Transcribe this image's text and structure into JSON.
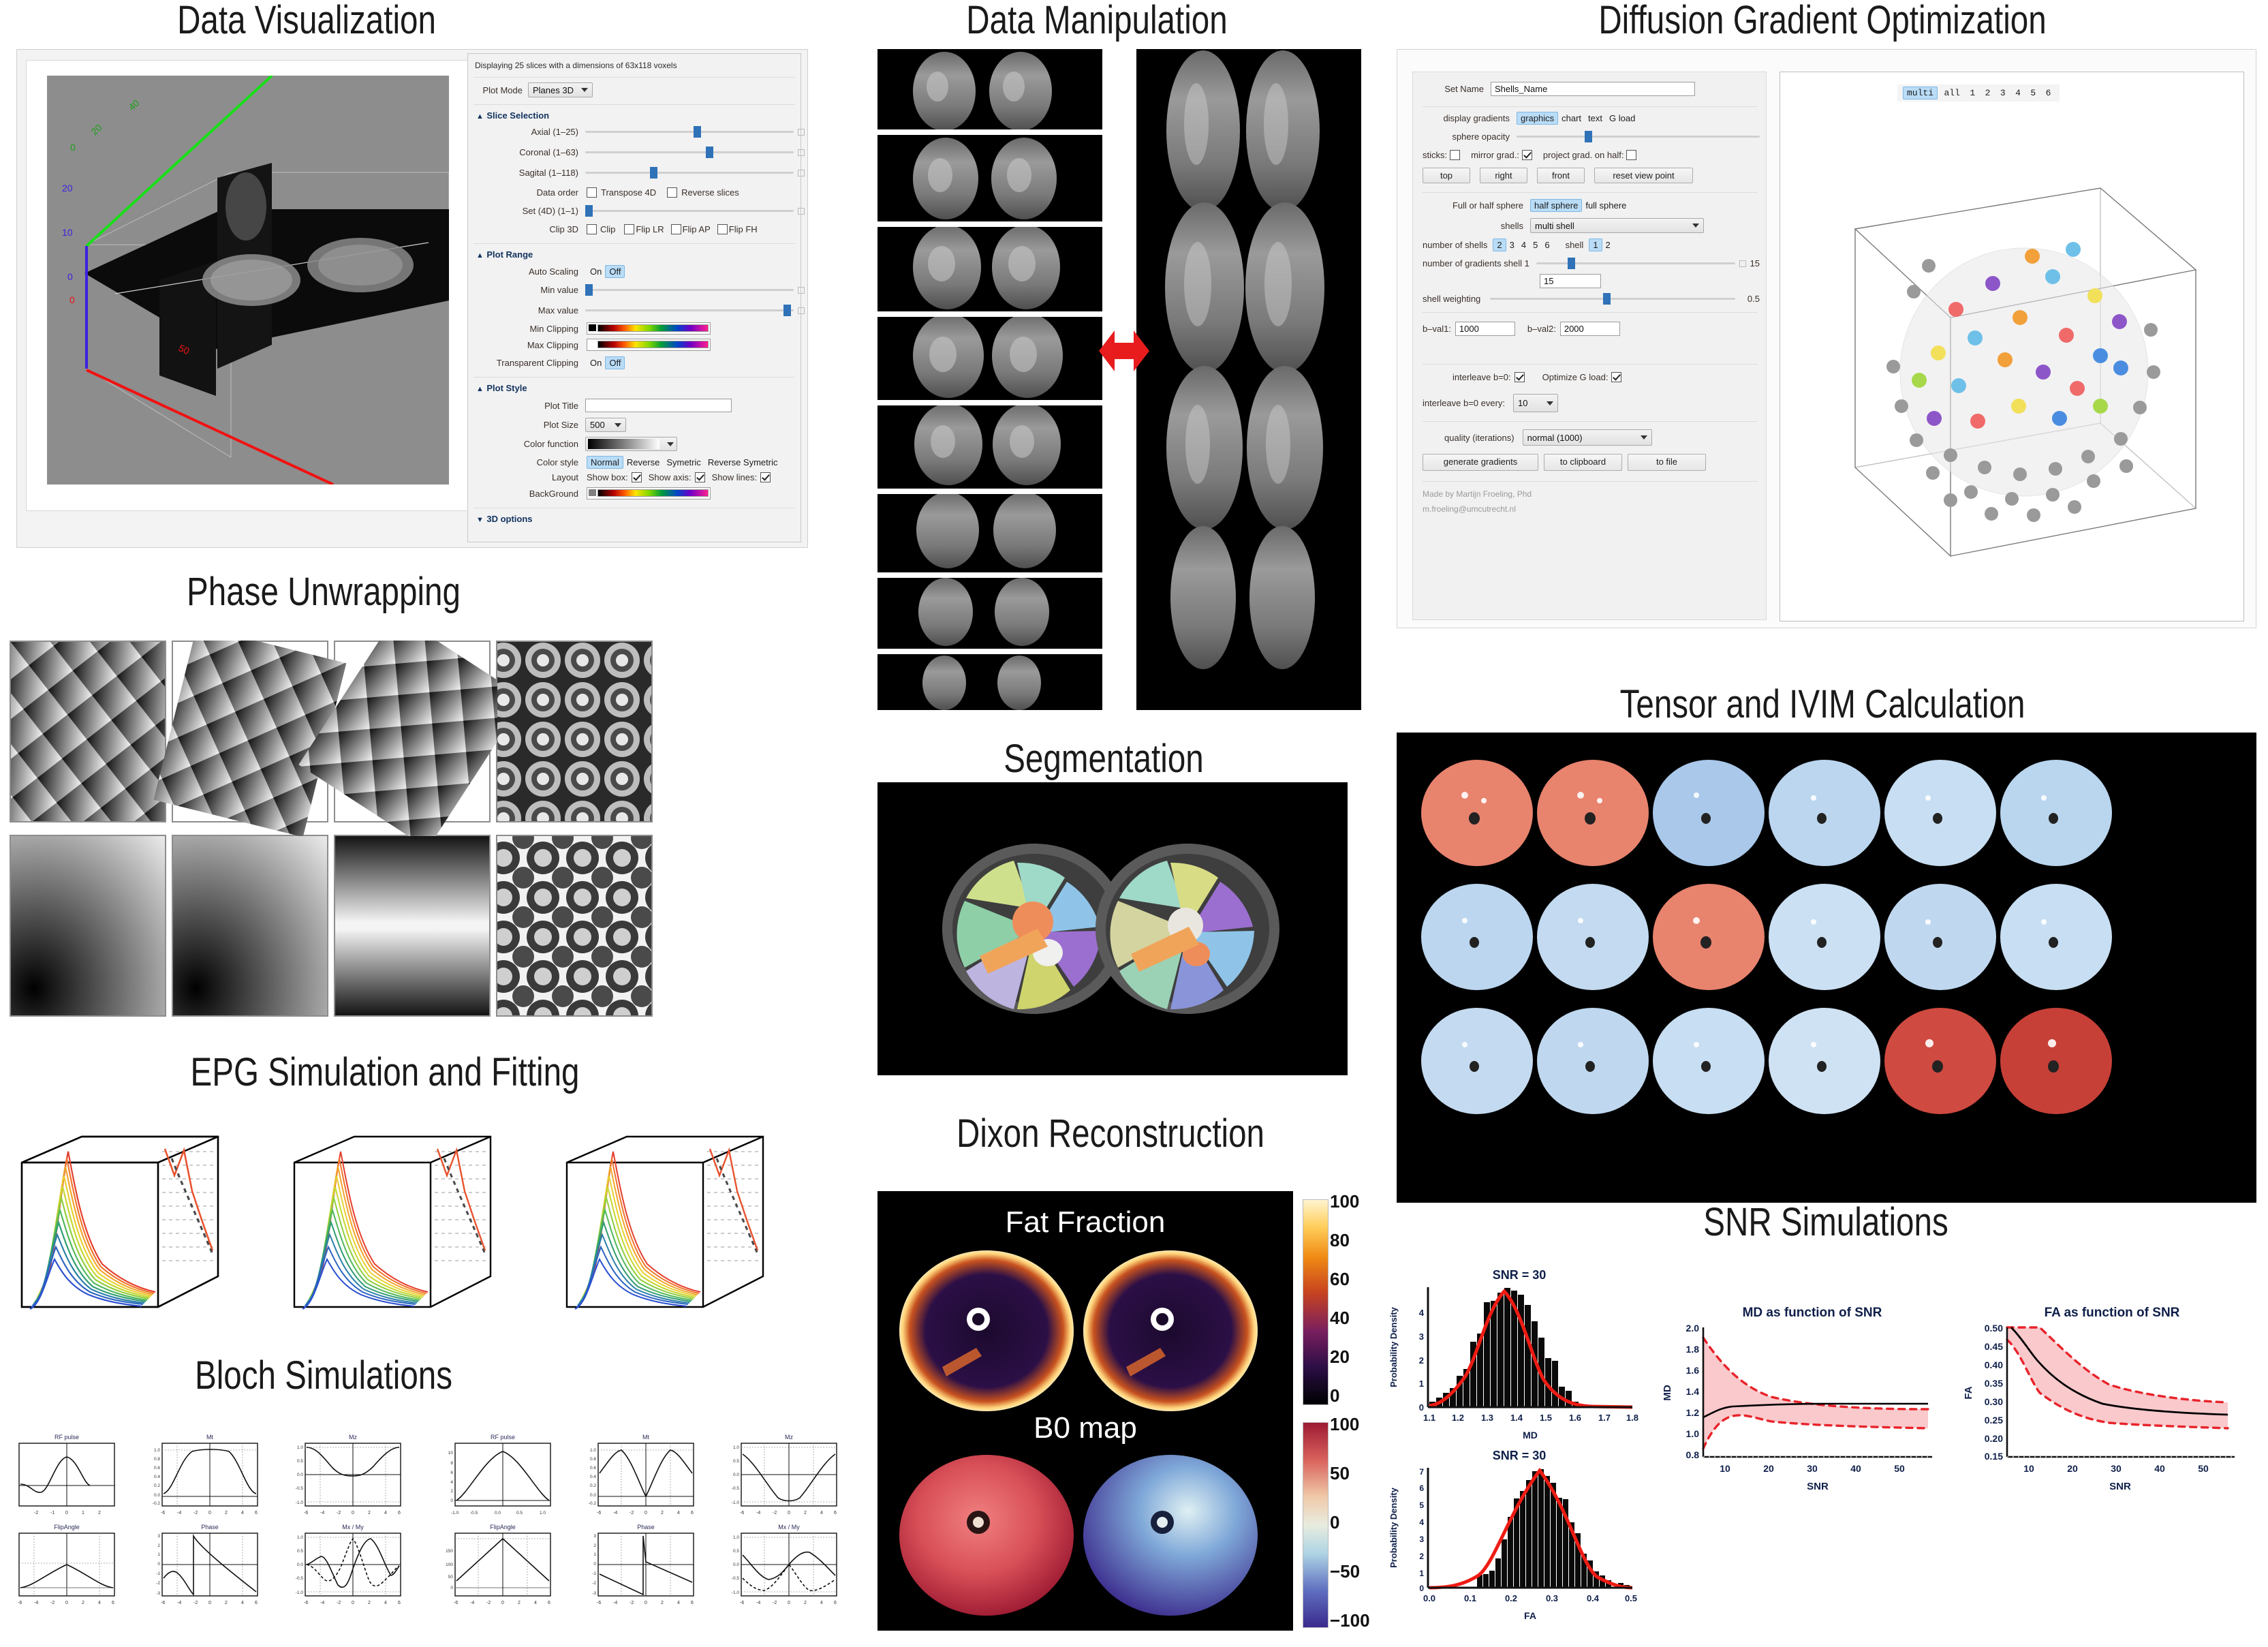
{
  "sections": {
    "data_visualization": "Data Visualization",
    "phase_unwrapping": "Phase Unwrapping",
    "epg": "EPG Simulation and Fitting",
    "bloch": "Bloch Simulations",
    "data_manipulation": "Data Manipulation",
    "segmentation": "Segmentation",
    "dixon": "Dixon Reconstruction",
    "dgo": "Diffusion Gradient Optimization",
    "tensor_ivim": "Tensor and IVIM Calculation",
    "snr": "SNR Simulations"
  },
  "viewer": {
    "status": "Displaying 25 slices with a dimensions of 63x118 voxels",
    "plot_mode_label": "Plot Mode",
    "plot_mode_value": "Planes 3D",
    "slice_selection": {
      "title": "Slice Selection",
      "rows": [
        {
          "label": "Axial (1–25)",
          "pos": 52
        },
        {
          "label": "Coronal (1–63)",
          "pos": 58
        },
        {
          "label": "Sagital (1–118)",
          "pos": 31
        }
      ],
      "data_order_label": "Data order",
      "transpose_label": "Transpose 4D",
      "transpose_checked": false,
      "reverse_label": "Reverse slices",
      "reverse_checked": false,
      "set4d_label": "Set (4D)  (1–1)",
      "set4d_pos": 1,
      "clip3d_label": "Clip 3D",
      "clip_options": [
        {
          "label": "Clip",
          "checked": false
        },
        {
          "label": "Flip LR",
          "checked": false
        },
        {
          "label": "Flip AP",
          "checked": false
        },
        {
          "label": "Flip FH",
          "checked": false
        }
      ]
    },
    "plot_range": {
      "title": "Plot Range",
      "auto_scaling_label": "Auto Scaling",
      "auto_on": "On",
      "auto_off": "Off",
      "auto_selected": "Off",
      "min_value_label": "Min value",
      "min_value_pos": 1,
      "max_value_label": "Max value",
      "max_value_pos": 95,
      "min_clipping_label": "Min Clipping",
      "max_clipping_label": "Max Clipping",
      "transparent_clipping_label": "Transparent Clipping",
      "transparent_on": "On",
      "transparent_off": "Off",
      "transparent_selected": "Off"
    },
    "plot_style": {
      "title": "Plot Style",
      "plot_title_label": "Plot Title",
      "plot_title_value": "",
      "plot_size_label": "Plot Size",
      "plot_size_value": "500",
      "color_function_label": "Color function",
      "color_style_label": "Color style",
      "color_styles": [
        "Normal",
        "Reverse",
        "Symetric",
        "Reverse Symetric"
      ],
      "color_style_selected": "Normal",
      "layout_label": "Layout",
      "layout_options": [
        {
          "label": "Show box:",
          "checked": true
        },
        {
          "label": "Show axis:",
          "checked": true
        },
        {
          "label": "Show lines:",
          "checked": true
        }
      ],
      "background_label": "BackGround"
    },
    "options3d_title": "3D options",
    "axes": {
      "x_ticks": [
        "0",
        "50"
      ],
      "y_ticks": [
        "0",
        "20",
        "40"
      ],
      "z_ticks": [
        "0",
        "10",
        "20"
      ]
    }
  },
  "gradient_tool": {
    "set_name_label": "Set Name",
    "set_name_value": "Shells_Name",
    "display_gradients_label": "display gradients",
    "display_modes": [
      "graphics",
      "chart",
      "text",
      "G load"
    ],
    "display_mode_selected": "graphics",
    "sphere_opacity_label": "sphere opacity",
    "sphere_opacity_pos": 28,
    "sticks_label": "sticks:",
    "sticks_checked": false,
    "mirror_label": "mirror grad.:",
    "mirror_checked": true,
    "project_label": "project grad. on half:",
    "project_checked": false,
    "view_buttons": [
      "top",
      "right",
      "front",
      "reset view point"
    ],
    "full_half_label": "Full or half sphere",
    "sphere_modes": [
      "half sphere",
      "full sphere"
    ],
    "sphere_mode_selected": "half sphere",
    "shells_label": "shells",
    "shells_value": "multi shell",
    "num_shells_label": "number of shells",
    "num_shells_options": [
      "2",
      "3",
      "4",
      "5",
      "6"
    ],
    "num_shells_selected": "2",
    "shell_label": "shell",
    "shell_options": [
      "1",
      "2"
    ],
    "shell_selected": "1",
    "num_gradients_label": "number of gradients shell 1",
    "num_gradients_pos": 16,
    "num_gradients_value": "15",
    "num_gradients_field": "15",
    "shell_weighting_label": "shell weighting",
    "shell_weighting_pos": 46,
    "shell_weighting_value": "0.5",
    "bval1_label": "b–val1:",
    "bval1_value": "1000",
    "bval2_label": "b–val2:",
    "bval2_value": "2000",
    "interleave_label": "interleave b=0:",
    "interleave_checked": true,
    "optimize_label": "Optimize G load:",
    "optimize_checked": true,
    "interleave_every_label": "interleave b=0 every:",
    "interleave_every_value": "10",
    "quality_label": "quality (iterations)",
    "quality_value": "normal (1000)",
    "action_buttons": [
      "generate gradients",
      "to clipboard",
      "to file"
    ],
    "credit_line1": "Made by Martijn Froeling, Phd",
    "credit_line2": "m.froeling@umcutrecht.nl",
    "shell_tabs": [
      "multi",
      "all",
      "1",
      "2",
      "3",
      "4",
      "5",
      "6"
    ],
    "shell_tab_selected": "multi"
  },
  "dixon": {
    "fat_fraction_label": "Fat Fraction",
    "b0_label": "B0 map",
    "colorbar_fat": {
      "ticks": [
        "100",
        "80",
        "60",
        "40",
        "20",
        "0"
      ]
    },
    "colorbar_b0": {
      "ticks": [
        "100",
        "50",
        "0",
        "−50",
        "−100"
      ]
    }
  },
  "chart_data": [
    {
      "type": "bar",
      "id": "md-histogram",
      "title": "SNR = 30",
      "xlabel": "MD",
      "ylabel": "Probability Density",
      "xlim": [
        1.1,
        1.8
      ],
      "ylim": [
        0,
        4.8
      ],
      "xticks": [
        "1.1",
        "1.2",
        "1.3",
        "1.4",
        "1.5",
        "1.6",
        "1.7",
        "1.8"
      ],
      "yticks": [
        "0",
        "1",
        "2",
        "3",
        "4"
      ],
      "bin_width": 0.02,
      "categories": [
        1.11,
        1.13,
        1.15,
        1.17,
        1.19,
        1.21,
        1.23,
        1.25,
        1.27,
        1.29,
        1.31,
        1.33,
        1.35,
        1.37,
        1.39,
        1.41,
        1.43,
        1.45,
        1.47,
        1.49,
        1.51,
        1.53,
        1.55,
        1.57
      ],
      "values": [
        0.15,
        0.25,
        0.35,
        0.5,
        0.85,
        1.05,
        1.8,
        2.1,
        3.55,
        3.6,
        4.15,
        4.5,
        4.4,
        4.25,
        3.85,
        3.2,
        2.55,
        1.85,
        1.75,
        0.75,
        0.6,
        0.2,
        0.07,
        0.03
      ],
      "fit_curve": {
        "name": "gaussian fit",
        "color": "#ee1c14",
        "mean": 1.335,
        "sigma": 0.085,
        "peak": 4.65
      },
      "grid": false,
      "legend": "none"
    },
    {
      "type": "bar",
      "id": "fa-histogram",
      "title": "SNR = 30",
      "xlabel": "FA",
      "ylabel": "Probability Density",
      "xlim": [
        0.0,
        0.5
      ],
      "ylim": [
        0,
        7.5
      ],
      "xticks": [
        "0.0",
        "0.1",
        "0.2",
        "0.3",
        "0.4",
        "0.5"
      ],
      "yticks": [
        "0",
        "1",
        "2",
        "3",
        "4",
        "5",
        "6",
        "7"
      ],
      "bin_width": 0.0125,
      "categories": [
        0.131,
        0.144,
        0.156,
        0.169,
        0.181,
        0.194,
        0.206,
        0.219,
        0.231,
        0.244,
        0.256,
        0.269,
        0.281,
        0.294,
        0.306,
        0.319,
        0.331,
        0.344,
        0.356,
        0.369,
        0.381,
        0.394,
        0.419,
        0.431
      ],
      "values": [
        0.8,
        0.85,
        1.05,
        1.8,
        3.0,
        4.35,
        5.45,
        5.9,
        6.55,
        7.1,
        7.25,
        6.85,
        6.4,
        5.5,
        5.4,
        4.0,
        3.35,
        2.1,
        1.65,
        1.0,
        0.75,
        0.45,
        0.3,
        0.15
      ],
      "fit_curve": {
        "name": "gaussian fit",
        "color": "#ee1c14",
        "mean": 0.258,
        "sigma": 0.0525,
        "peak": 7.3
      },
      "grid": false,
      "legend": "none"
    },
    {
      "type": "line",
      "id": "md-vs-snr",
      "title": "MD as function of SNR",
      "xlabel": "SNR",
      "ylabel": "MD",
      "xlim": [
        5,
        57
      ],
      "ylim": [
        0.8,
        2.0
      ],
      "xticks": [
        "10",
        "20",
        "30",
        "40",
        "50"
      ],
      "yticks": [
        "0.8",
        "1.0",
        "1.2",
        "1.4",
        "1.6",
        "1.8",
        "2.0"
      ],
      "x": [
        5,
        10,
        15,
        20,
        25,
        30,
        35,
        40,
        45,
        50,
        55,
        57
      ],
      "series": [
        {
          "name": "mean",
          "style": "solid",
          "color": "#000000",
          "values": [
            1.253,
            1.313,
            1.315,
            1.327,
            1.328,
            1.33,
            1.33,
            1.331,
            1.331,
            1.332,
            1.332,
            1.332
          ]
        },
        {
          "name": "upper bound",
          "style": "dashed",
          "color": "#e8232a",
          "values": [
            1.745,
            1.56,
            1.487,
            1.44,
            1.418,
            1.405,
            1.396,
            1.389,
            1.384,
            1.38,
            1.376,
            1.375
          ]
        },
        {
          "name": "lower bound",
          "style": "dashed",
          "color": "#e8232a",
          "values": [
            0.792,
            1.085,
            1.16,
            1.205,
            1.232,
            1.25,
            1.262,
            1.27,
            1.277,
            1.282,
            1.287,
            1.289
          ]
        }
      ],
      "band_color": "#f9c9cc",
      "grid": false,
      "legend": "none"
    },
    {
      "type": "line",
      "id": "fa-vs-snr",
      "title": "FA as function of SNR",
      "xlabel": "SNR",
      "ylabel": "FA",
      "xlim": [
        5,
        57
      ],
      "ylim": [
        0.15,
        0.5
      ],
      "xticks": [
        "10",
        "20",
        "30",
        "40",
        "50"
      ],
      "yticks": [
        "0.15",
        "0.20",
        "0.25",
        "0.30",
        "0.35",
        "0.40",
        "0.45",
        "0.50"
      ],
      "x": [
        5,
        10,
        15,
        20,
        25,
        30,
        35,
        40,
        45,
        50,
        55,
        57
      ],
      "series": [
        {
          "name": "mean",
          "style": "solid",
          "color": "#000000",
          "values": [
            0.5,
            0.417,
            0.337,
            0.291,
            0.268,
            0.252,
            0.247,
            0.243,
            0.24,
            0.237,
            0.235,
            0.234
          ]
        },
        {
          "name": "upper bound",
          "style": "dashed",
          "color": "#e8232a",
          "values": [
            0.62,
            0.5,
            0.418,
            0.362,
            0.33,
            0.305,
            0.292,
            0.283,
            0.276,
            0.271,
            0.267,
            0.266
          ]
        },
        {
          "name": "lower bound",
          "style": "dashed",
          "color": "#e8232a",
          "values": [
            0.395,
            0.283,
            0.237,
            0.214,
            0.205,
            0.199,
            0.198,
            0.197,
            0.197,
            0.197,
            0.198,
            0.198
          ]
        }
      ],
      "band_color": "#f9c9cc",
      "grid": false,
      "legend": "none"
    }
  ],
  "bloch": {
    "panels": [
      {
        "titles": [
          "RF pulse",
          "FlipAngle"
        ],
        "xticks": [
          "-2",
          "-1",
          "0",
          "1",
          "2"
        ]
      },
      {
        "titles": [
          "Mt",
          "Phase"
        ],
        "yticks_top": [
          "1.0",
          "0.8",
          "0.6",
          "0.4",
          "0.2",
          "0.0",
          "-0.2"
        ],
        "yticks_bottom": [
          "3",
          "2",
          "1",
          "0",
          "-1",
          "-2",
          "-3"
        ],
        "xticks": [
          "-6",
          "-4",
          "-2",
          "0",
          "2",
          "4",
          "6"
        ]
      },
      {
        "titles": [
          "Mz",
          "Mx / My"
        ],
        "yticks": [
          "1.0",
          "0.5",
          "0.0",
          "-0.5",
          "-1.0"
        ],
        "xticks": [
          "-6",
          "-4",
          "-2",
          "0",
          "2",
          "4",
          "6"
        ]
      },
      {
        "titles": [
          "RF pulse",
          "FlipAngle"
        ],
        "yticks_top": [
          "10",
          "8",
          "6",
          "4",
          "2",
          "0"
        ],
        "yticks_bottom": [
          "150",
          "100",
          "50",
          "0"
        ],
        "xticks": [
          "-1.0",
          "-0.5",
          "0.0",
          "0.5",
          "1.0"
        ]
      },
      {
        "titles": [
          "Mt",
          "Phase"
        ],
        "yticks_top": [
          "1.0",
          "0.8",
          "0.6",
          "0.4",
          "0.2",
          "0.0",
          "-0.2"
        ],
        "yticks_bottom": [
          "3",
          "2",
          "1",
          "0",
          "-1",
          "-2",
          "-3"
        ],
        "xticks": [
          "-6",
          "-4",
          "-2",
          "0",
          "2",
          "4",
          "6"
        ]
      },
      {
        "titles": [
          "Mz",
          "Mx / My"
        ],
        "yticks": [
          "1.0",
          "0.5",
          "0.0",
          "-0.5",
          "-1.0"
        ],
        "xticks": [
          "-6",
          "-4",
          "-2",
          "0",
          "2",
          "4",
          "6"
        ]
      }
    ]
  }
}
